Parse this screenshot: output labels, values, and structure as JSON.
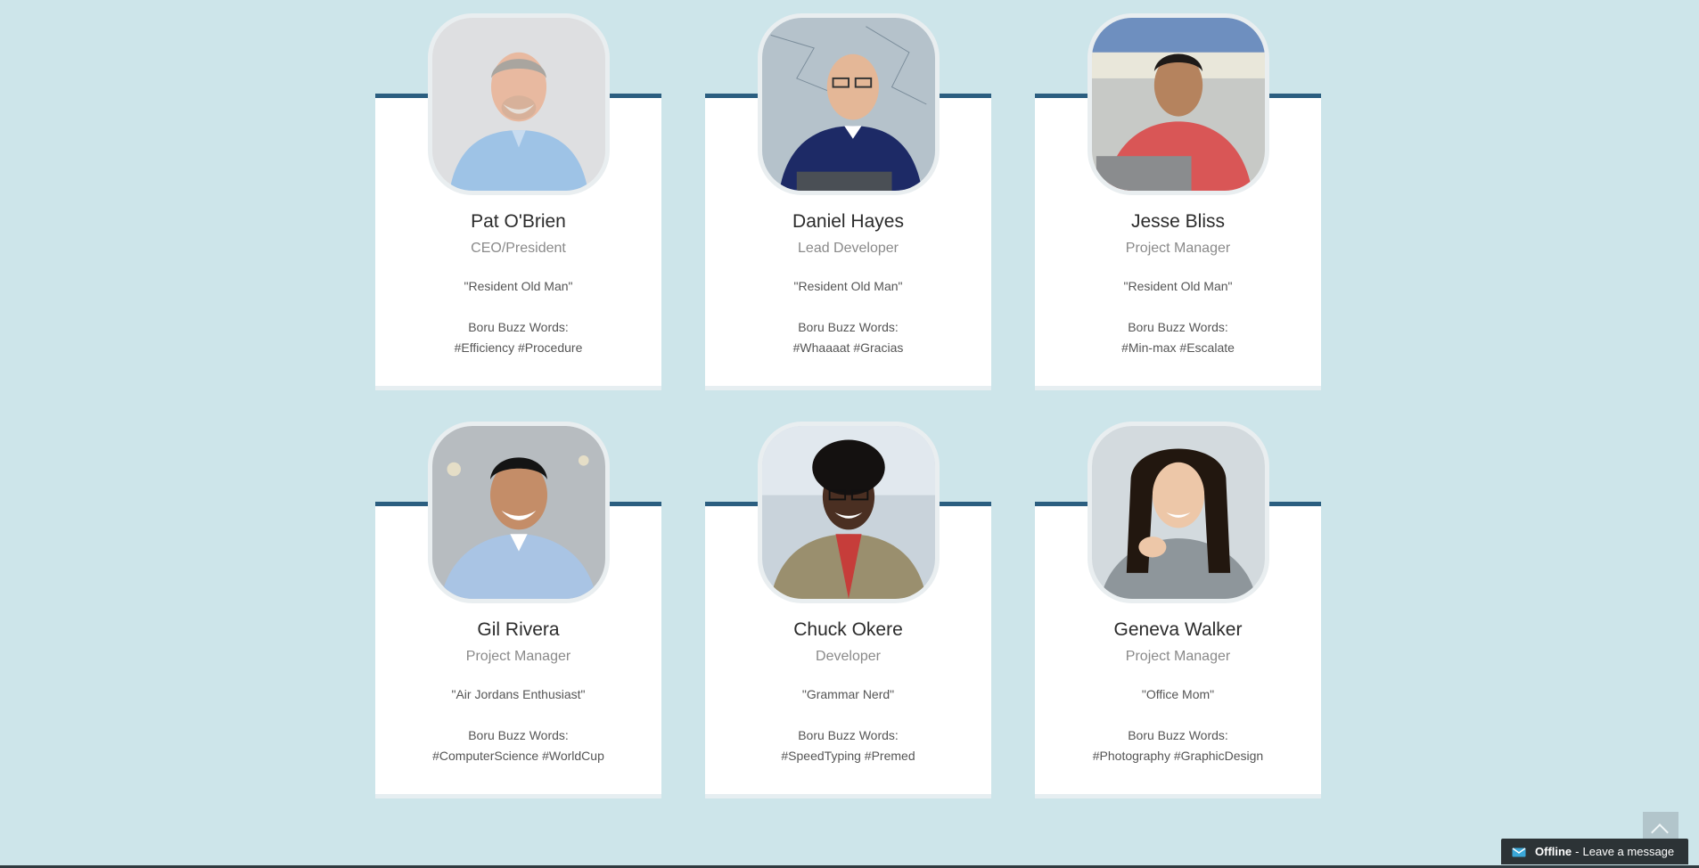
{
  "team": [
    {
      "name": "Pat O'Brien",
      "role": "CEO/President",
      "nickname": "\"Resident Old Man\"",
      "buzz_label": "Boru Buzz Words:",
      "buzz_tags": "#Efficiency #Procedure"
    },
    {
      "name": "Daniel Hayes",
      "role": "Lead Developer",
      "nickname": "\"Resident Old Man\"",
      "buzz_label": "Boru Buzz Words:",
      "buzz_tags": "#Whaaaat #Gracias"
    },
    {
      "name": "Jesse Bliss",
      "role": "Project Manager",
      "nickname": "\"Resident Old Man\"",
      "buzz_label": "Boru Buzz Words:",
      "buzz_tags": "#Min-max #Escalate"
    },
    {
      "name": "Gil Rivera",
      "role": "Project Manager",
      "nickname": "\"Air Jordans Enthusiast\"",
      "buzz_label": "Boru Buzz Words:",
      "buzz_tags": "#ComputerScience #WorldCup"
    },
    {
      "name": "Chuck Okere",
      "role": "Developer",
      "nickname": "\"Grammar Nerd\"",
      "buzz_label": "Boru Buzz Words:",
      "buzz_tags": "#SpeedTyping #Premed"
    },
    {
      "name": "Geneva Walker",
      "role": "Project Manager",
      "nickname": "\"Office Mom\"",
      "buzz_label": "Boru Buzz Words:",
      "buzz_tags": "#Photography #GraphicDesign"
    }
  ],
  "chat": {
    "status": "Offline",
    "separator": "-",
    "message": "Leave a message"
  },
  "icons": {
    "scroll_top": "chevron-up-icon",
    "chat": "envelope-icon"
  },
  "colors": {
    "page_background": "#cde5ea",
    "card_accent": "#2b5e80",
    "chat_bar": "#2c3336"
  }
}
